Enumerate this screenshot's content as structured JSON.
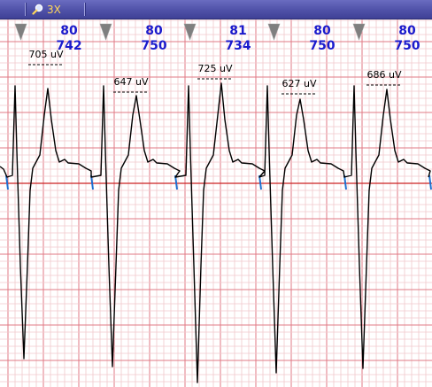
{
  "toolbar": {
    "zoom_label": "3X",
    "zoom_icon": "magnifier-icon"
  },
  "colors": {
    "toolbar_bg": "#4f51a8",
    "grid_minor": "#f0c8cc",
    "grid_major": "#e07a84",
    "baseline": "#cc2222",
    "trace": "#000000",
    "beat_marker": "#1e6fd0",
    "hr_text": "#1a1acc"
  },
  "beats": [
    {
      "hr": "80",
      "rr": "742",
      "amplitude": "705 uV"
    },
    {
      "hr": "80",
      "rr": "750",
      "amplitude": "647 uV"
    },
    {
      "hr": "81",
      "rr": "734",
      "amplitude": "725 uV"
    },
    {
      "hr": "80",
      "rr": "750",
      "amplitude": "627 uV"
    },
    {
      "hr": "80",
      "rr": "750",
      "amplitude": "686 uV"
    }
  ]
}
